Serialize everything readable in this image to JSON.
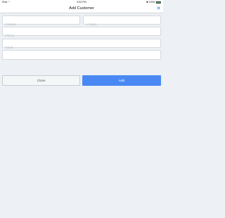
{
  "status_bar": {
    "device": "iPad",
    "wifi_icon": "wifi-icon",
    "time": "9:03 PM",
    "bluetooth_icon": "bluetooth-icon",
    "battery_text": "100%",
    "battery_level": 1.0
  },
  "navbar": {
    "title": "Add Customer",
    "close_icon": "close-icon",
    "accent_color": "#2b6fd6"
  },
  "form": {
    "first_name": {
      "placeholder": "F.Name",
      "value": ""
    },
    "last_name": {
      "placeholder": "L.Name",
      "value": ""
    },
    "phone": {
      "placeholder": "Phone",
      "value": ""
    },
    "email": {
      "placeholder": "Email",
      "value": ""
    },
    "extra": {
      "placeholder": "",
      "value": ""
    }
  },
  "actions": {
    "close_label": "Close",
    "add_label": "Add",
    "add_color": "#4a89f3"
  }
}
